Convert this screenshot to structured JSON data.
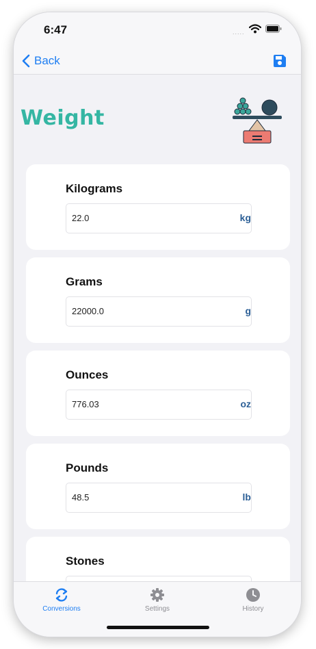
{
  "status": {
    "time": "6:47",
    "signal": "....."
  },
  "nav": {
    "back_label": "Back"
  },
  "page": {
    "title": "Weight"
  },
  "conversions": [
    {
      "label": "Kilograms",
      "value": "22.0",
      "unit": "kg"
    },
    {
      "label": "Grams",
      "value": "22000.0",
      "unit": "g"
    },
    {
      "label": "Ounces",
      "value": "776.03",
      "unit": "oz"
    },
    {
      "label": "Pounds",
      "value": "48.5",
      "unit": "lb"
    },
    {
      "label": "Stones",
      "value": "",
      "unit": ""
    }
  ],
  "tabs": [
    {
      "label": "Conversions",
      "icon": "conversions-icon",
      "active": true
    },
    {
      "label": "Settings",
      "icon": "gear-icon",
      "active": false
    },
    {
      "label": "History",
      "icon": "clock-icon",
      "active": false
    }
  ],
  "colors": {
    "accent": "#1e7ef2",
    "title": "#35b6a3",
    "unit": "#2c5f96",
    "inactive_tab": "#8e8e93"
  }
}
